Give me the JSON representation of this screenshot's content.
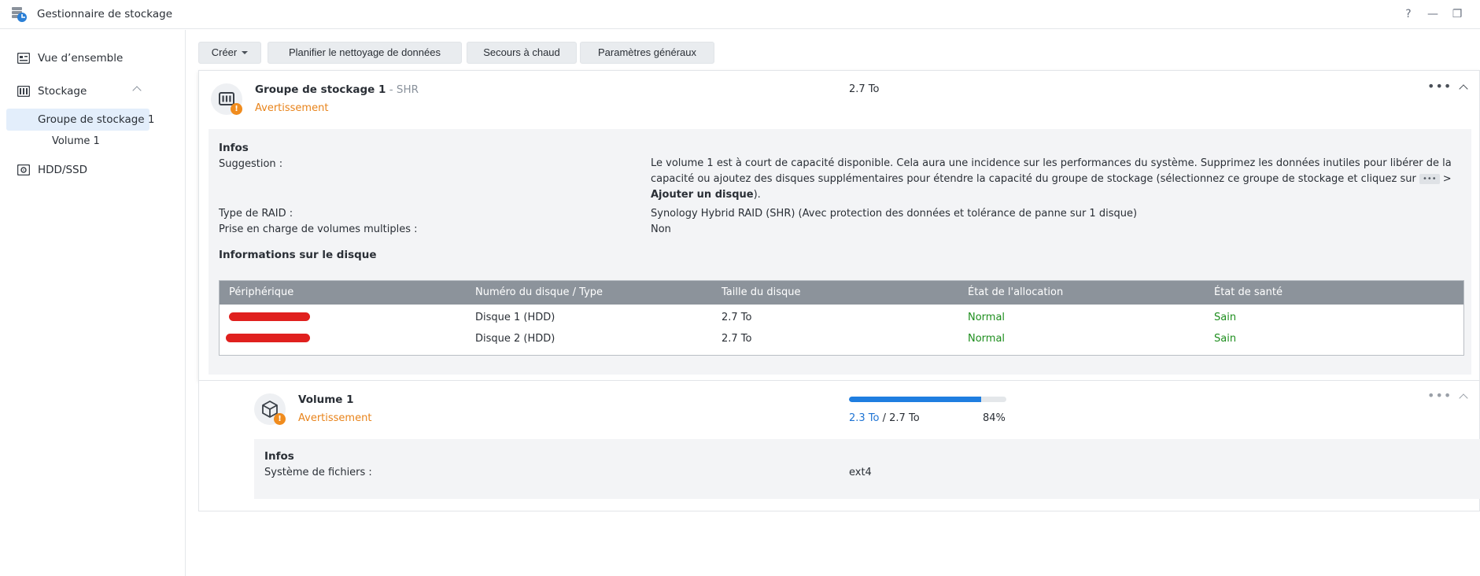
{
  "window": {
    "title": "Gestionnaire de stockage",
    "help": "?",
    "minimize": "—",
    "restore": "❐"
  },
  "sidebar": {
    "items": [
      {
        "label": "Vue d’ensemble",
        "icon": "overview-icon"
      },
      {
        "label": "Stockage",
        "icon": "storage-icon",
        "expanded": true
      },
      {
        "label": "Groupe de stockage 1",
        "active": true
      },
      {
        "label": "Volume 1"
      },
      {
        "label": "HDD/SSD",
        "icon": "hdd-icon"
      }
    ]
  },
  "toolbar": {
    "create": "Créer",
    "schedule": "Planifier le nettoyage de données",
    "hotspare": "Secours à chaud",
    "settings": "Paramètres généraux"
  },
  "pool": {
    "title": "Groupe de stockage 1",
    "type": " - SHR",
    "status": "Avertissement",
    "capacity": "2.7 To",
    "info_title": "Infos",
    "suggestion_label": "Suggestion :",
    "suggestion_text_1": "Le volume 1 est à court de capacité disponible. Cela aura une incidence sur les performances du système. Supprimez les données inutiles pour libérer de la capacité ou ajoutez des disques supplémentaires pour étendre la capacité du groupe de stockage (sélectionnez ce groupe de stockage et cliquez sur",
    "suggestion_kbd": "•••",
    "suggestion_text_2": " > ",
    "suggestion_bold": "Ajouter un disque",
    "suggestion_text_3": ").",
    "raid_label": "Type de RAID :",
    "raid_value": "Synology Hybrid RAID (SHR) (Avec protection des données et tolérance de panne sur 1 disque)",
    "multivol_label": "Prise en charge de volumes multiples :",
    "multivol_value": "Non",
    "disk_info_title": "Informations sur le disque",
    "disk_table": {
      "headers": [
        "Périphérique",
        "Numéro du disque / Type",
        "Taille du disque",
        "État de l'allocation",
        "État de santé"
      ],
      "rows": [
        {
          "disk": "Disque 1 (HDD)",
          "size": "2.7 To",
          "alloc": "Normal",
          "health": "Sain"
        },
        {
          "disk": "Disque 2 (HDD)",
          "size": "2.7 To",
          "alloc": "Normal",
          "health": "Sain"
        }
      ]
    }
  },
  "volume": {
    "title": "Volume 1",
    "status": "Avertissement",
    "used": "2.3 To",
    "separator": " / ",
    "total": "2.7 To",
    "percent": "84%",
    "usage_fraction": 0.84,
    "info_title": "Infos",
    "fs_label": "Système de fichiers :",
    "fs_value": "ext4"
  },
  "colors": {
    "warning": "#e8831a",
    "healthy": "#1e8e1e",
    "accent": "#1f7ee0"
  }
}
